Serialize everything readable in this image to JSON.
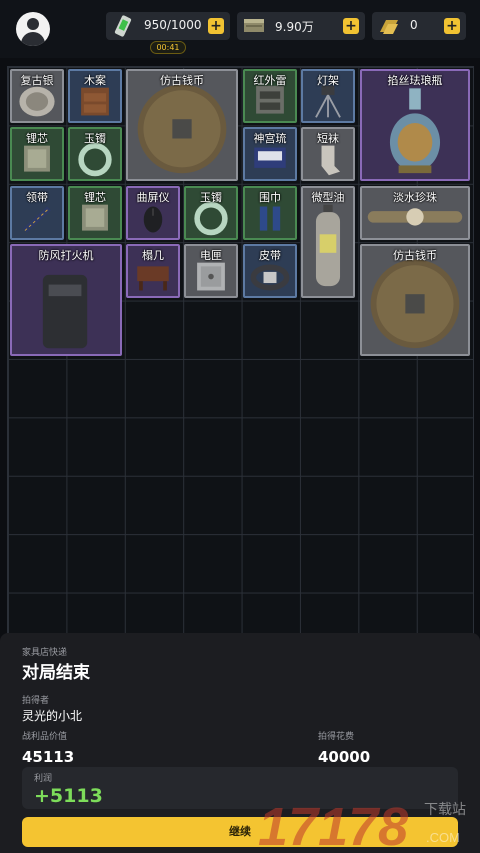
{
  "topbar": {
    "energy": "950/1000",
    "cash": "9.90万",
    "gold": "0",
    "plus": "+",
    "timer": "00:41"
  },
  "items": [
    {
      "label": "复古银",
      "rarity": "gray"
    },
    {
      "label": "木案",
      "rarity": "blue"
    },
    {
      "label": "仿古钱币",
      "rarity": "gray"
    },
    {
      "label": "红外雷",
      "rarity": "green"
    },
    {
      "label": "灯架",
      "rarity": "blue"
    },
    {
      "label": "掐丝珐琅瓶",
      "rarity": "purple"
    },
    {
      "label": "锂芯",
      "rarity": "green"
    },
    {
      "label": "玉镯",
      "rarity": "green"
    },
    {
      "label": "神宫琉",
      "rarity": "blue"
    },
    {
      "label": "短袜",
      "rarity": "gray"
    },
    {
      "label": "领带",
      "rarity": "blue"
    },
    {
      "label": "锂芯",
      "rarity": "green"
    },
    {
      "label": "曲屏仪",
      "rarity": "purple"
    },
    {
      "label": "玉镯",
      "rarity": "green"
    },
    {
      "label": "围巾",
      "rarity": "green"
    },
    {
      "label": "微型油",
      "rarity": "gray"
    },
    {
      "label": "淡水珍珠",
      "rarity": "gray"
    },
    {
      "label": "防风打火机",
      "rarity": "purple"
    },
    {
      "label": "榻几",
      "rarity": "purple"
    },
    {
      "label": "电匣",
      "rarity": "gray"
    },
    {
      "label": "皮带",
      "rarity": "blue"
    },
    {
      "label": "仿古钱币",
      "rarity": "gray"
    }
  ],
  "panel": {
    "subtitle": "家具店快递",
    "title": "对局结束",
    "finder_label": "拍得者",
    "finder_name": "灵光的小北",
    "value_label": "战利品价值",
    "value": "45113",
    "cost_label": "拍得花费",
    "cost": "40000",
    "profit_label": "利润",
    "profit": "+5113",
    "continue_label": "继续"
  },
  "watermark": {
    "text": "17178",
    "sub": "下载站",
    "suffix": ".COM"
  }
}
